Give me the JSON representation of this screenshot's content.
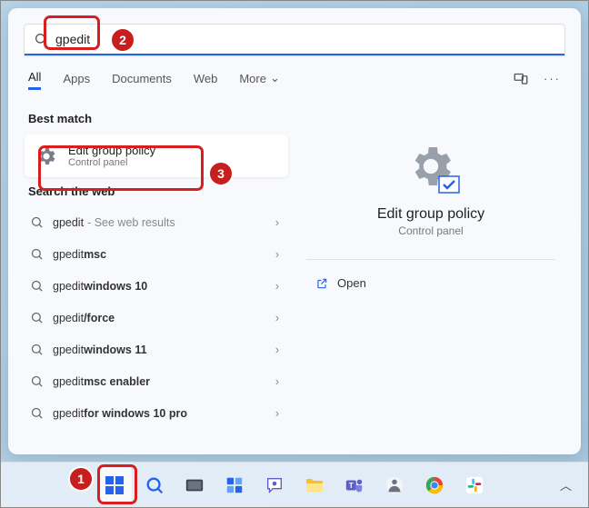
{
  "search": {
    "query": "gpedit"
  },
  "tabs": {
    "all": "All",
    "apps": "Apps",
    "documents": "Documents",
    "web": "Web",
    "more": "More"
  },
  "sections": {
    "best_match": "Best match",
    "search_web": "Search the web"
  },
  "best_match": {
    "title": "Edit group policy",
    "subtitle": "Control panel"
  },
  "web_results": [
    {
      "prefix": "gpedit",
      "suffix": " - See web results"
    },
    {
      "prefix": "gpedit ",
      "bold": "msc"
    },
    {
      "prefix": "gpedit ",
      "bold": "windows 10"
    },
    {
      "prefix": "gpedit ",
      "bold": "/force"
    },
    {
      "prefix": "gpedit ",
      "bold": "windows 11"
    },
    {
      "prefix": "gpedit ",
      "bold": "msc enabler"
    },
    {
      "prefix": "gpedit ",
      "bold": "for windows 10 pro"
    }
  ],
  "preview": {
    "title": "Edit group policy",
    "subtitle": "Control panel",
    "open": "Open"
  },
  "badges": {
    "b1": "1",
    "b2": "2",
    "b3": "3"
  }
}
